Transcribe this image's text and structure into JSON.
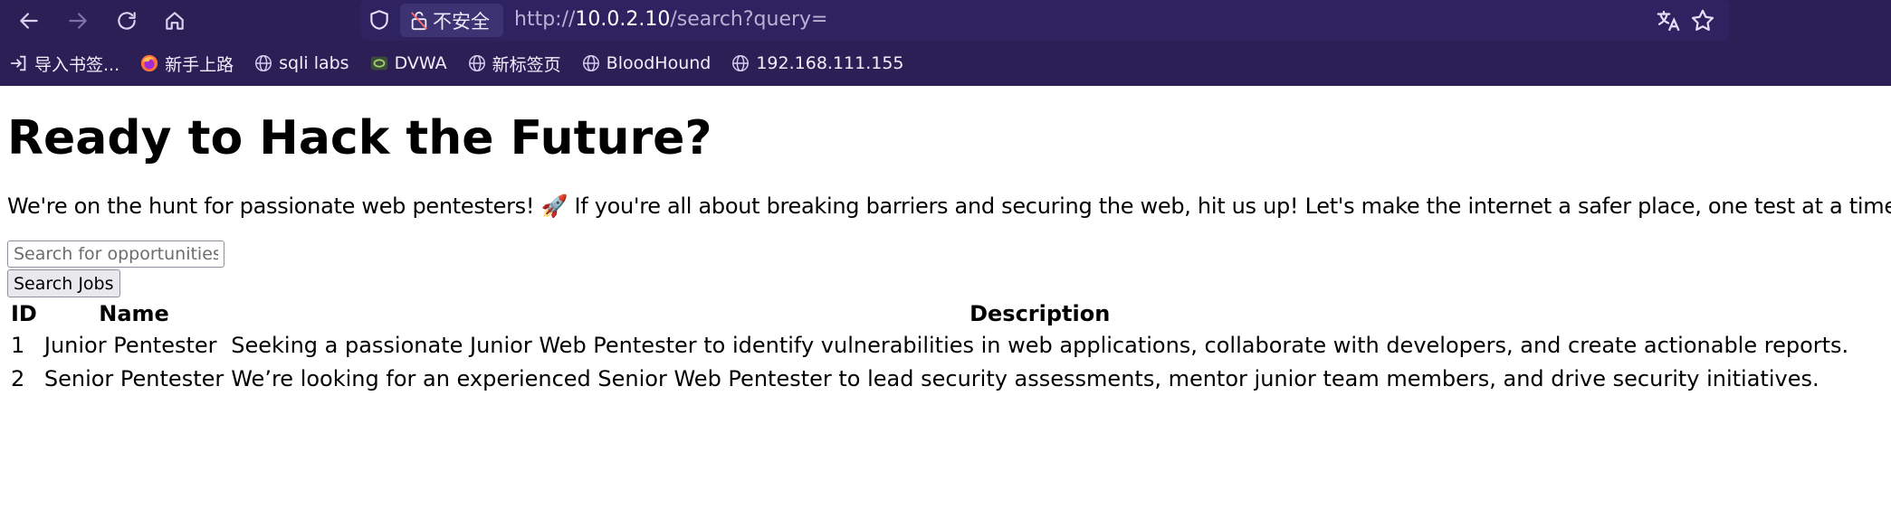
{
  "browser": {
    "security_label": "不安全",
    "url_scheme": "http://",
    "url_host": "10.0.2.10",
    "url_path": "/search?query=",
    "bookmarks": [
      {
        "label": "导入书签...",
        "icon": "import-icon"
      },
      {
        "label": "新手上路",
        "icon": "firefox-icon"
      },
      {
        "label": "sqli labs",
        "icon": "globe-icon"
      },
      {
        "label": "DVWA",
        "icon": "dvwa-icon"
      },
      {
        "label": "新标签页",
        "icon": "globe-icon"
      },
      {
        "label": "BloodHound",
        "icon": "globe-icon"
      },
      {
        "label": "192.168.111.155",
        "icon": "globe-icon"
      }
    ],
    "colors": {
      "chrome_bg": "#2b1f55",
      "urlbar_bg": "#2e2260"
    }
  },
  "page": {
    "title": "Ready to Hack the Future?",
    "intro": "We're on the hunt for passionate web pentesters! 🚀 If you're all about breaking barriers and securing the web, hit us up! Let's make the internet a safer place, one test at a time.",
    "search_placeholder": "Search for opportunities...",
    "search_value": "",
    "search_button": "Search Jobs",
    "table": {
      "headers": [
        "ID",
        "Name",
        "Description"
      ],
      "rows": [
        [
          "1",
          "Junior Pentester",
          "Seeking a passionate Junior Web Pentester to identify vulnerabilities in web applications, collaborate with developers, and create actionable reports."
        ],
        [
          "2",
          "Senior Pentester",
          "We’re looking for an experienced Senior Web Pentester to lead security assessments, mentor junior team members, and drive security initiatives."
        ]
      ]
    }
  }
}
